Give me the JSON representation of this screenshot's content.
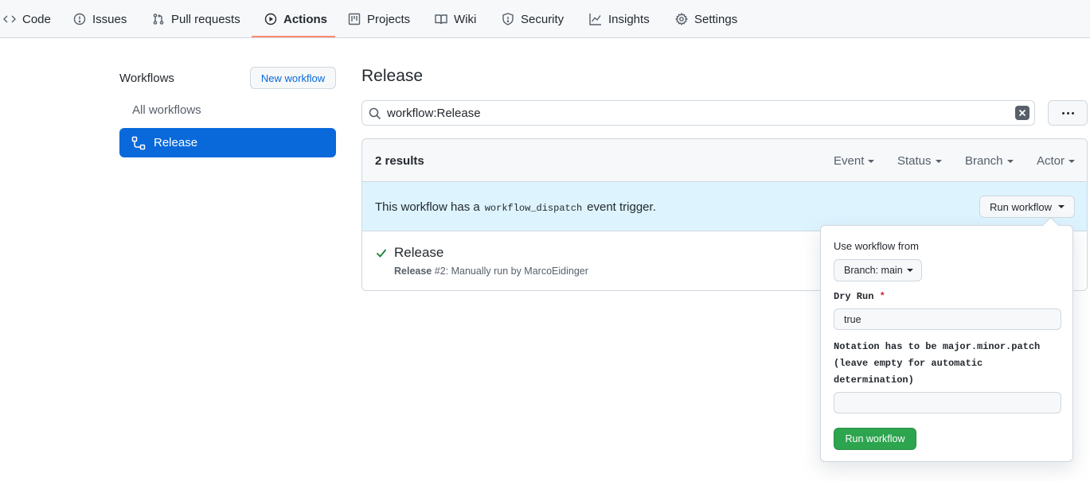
{
  "repo_nav": {
    "items": [
      {
        "label": "Code",
        "icon": "code-icon"
      },
      {
        "label": "Issues",
        "icon": "issue-icon"
      },
      {
        "label": "Pull requests",
        "icon": "pull-request-icon"
      },
      {
        "label": "Actions",
        "icon": "play-icon",
        "selected": true
      },
      {
        "label": "Projects",
        "icon": "project-icon"
      },
      {
        "label": "Wiki",
        "icon": "book-icon"
      },
      {
        "label": "Security",
        "icon": "shield-icon"
      },
      {
        "label": "Insights",
        "icon": "graph-icon"
      },
      {
        "label": "Settings",
        "icon": "gear-icon"
      }
    ],
    "selected_underline_color": "#fd8c73"
  },
  "sidebar": {
    "title": "Workflows",
    "new_workflow_label": "New workflow",
    "all_workflows_label": "All workflows",
    "selected_workflow_label": "Release",
    "selected_color": "#0969da"
  },
  "main": {
    "title": "Release",
    "search_value": "workflow:Release",
    "results_count": "2 results",
    "filters": {
      "event": "Event",
      "status": "Status",
      "branch": "Branch",
      "actor": "Actor"
    },
    "dispatch": {
      "text_before": "This workflow has a",
      "code": "workflow_dispatch",
      "text_after": "event trigger.",
      "run_button_label": "Run workflow"
    },
    "run": {
      "title": "Release",
      "meta_name": "Release",
      "meta_rest": "#2: Manually run by MarcoEidinger",
      "status_color": "#1a7f37"
    }
  },
  "popover": {
    "heading": "Use workflow from",
    "branch_label": "Branch: main",
    "dry_run_label": "Dry Run",
    "dry_run_required_mark": "*",
    "dry_run_value": "true",
    "notation_line1": "Notation has to be major.minor.patch",
    "notation_line2": "(leave empty for automatic",
    "notation_line3": "determination)",
    "notation_value": "",
    "submit_label": "Run workflow",
    "submit_color": "#2da44e"
  }
}
